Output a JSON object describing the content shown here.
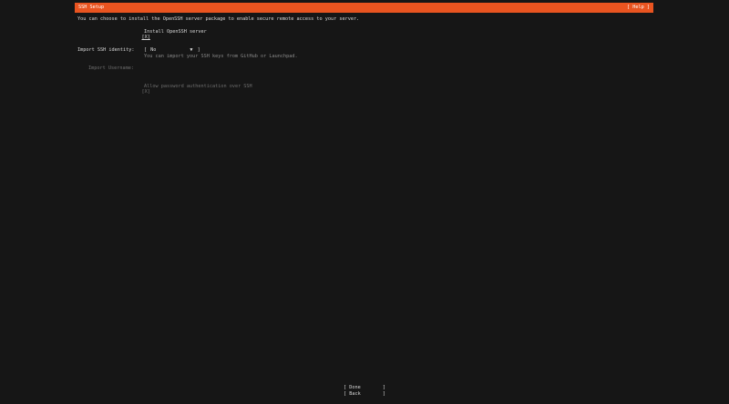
{
  "header": {
    "title": "SSH Setup",
    "help_label": "[ Help ]"
  },
  "main": {
    "intro": "You can choose to install the OpenSSH server package to enable secure remote access to your server.",
    "install_checkbox": {
      "box": "[X]",
      "label": "Install OpenSSH server"
    },
    "import_identity": {
      "label": "Import SSH identity:",
      "open_bracket": "[",
      "value": "No",
      "arrow": "▼",
      "close_bracket": "]",
      "hint": "You can import your SSH keys from GitHub or Launchpad."
    },
    "import_username": {
      "label": "Import Username:"
    },
    "allow_password": {
      "box": "[X]",
      "label": "Allow password authentication over SSH"
    }
  },
  "footer": {
    "done": {
      "open": "[",
      "label": "Done",
      "close": "]"
    },
    "back": {
      "open": "[",
      "label": "Back",
      "close": "]"
    }
  }
}
